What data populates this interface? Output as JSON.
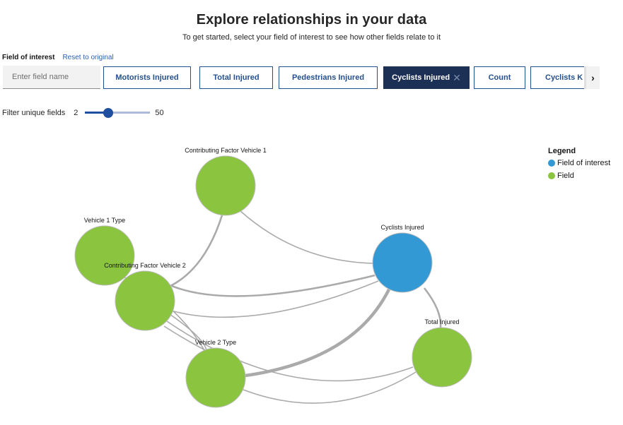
{
  "header": {
    "title": "Explore relationships in your data",
    "subtitle": "To get started, select your field of interest to see how other fields relate to it"
  },
  "field_of_interest": {
    "label": "Field of interest",
    "reset_label": "Reset to original",
    "input_placeholder": "Enter field name",
    "input_value": "",
    "chips": [
      {
        "label": "Motorists Injured",
        "selected": false
      },
      {
        "label": "Total Injured",
        "selected": false
      },
      {
        "label": "Pedestrians Injured",
        "selected": false
      },
      {
        "label": "Cyclists Injured",
        "selected": true,
        "close_icon": "close-icon"
      },
      {
        "label": "Count",
        "selected": false
      },
      {
        "label": "Cyclists K",
        "selected": false
      }
    ],
    "scroll_icon": "chevron-right-icon"
  },
  "filter": {
    "label": "Filter unique fields",
    "min": "2",
    "max": "50",
    "value_fraction": 0.35
  },
  "legend": {
    "title": "Legend",
    "items": [
      {
        "label": "Field of interest",
        "color": "#3399d4"
      },
      {
        "label": "Field",
        "color": "#8bc43f"
      }
    ]
  },
  "colors": {
    "field_of_interest": "#3399d4",
    "field": "#8bc43f",
    "edge": "#aaaaaa",
    "accent": "#24508f",
    "selected_chip": "#1c2f55"
  },
  "graph": {
    "nodes": [
      {
        "id": "cfv1",
        "label": "Contributing Factor Vehicle 1",
        "type": "field"
      },
      {
        "id": "v1t",
        "label": "Vehicle 1 Type",
        "type": "field"
      },
      {
        "id": "cfv2",
        "label": "Contributing Factor Vehicle 2",
        "type": "field"
      },
      {
        "id": "ci",
        "label": "Cyclists Injured",
        "type": "interest"
      },
      {
        "id": "ti",
        "label": "Total Injured",
        "type": "field"
      },
      {
        "id": "v2t",
        "label": "Vehicle 2 Type",
        "type": "field"
      }
    ],
    "edges": [
      {
        "source": "cfv1",
        "target": "ci",
        "weight": "light"
      },
      {
        "source": "cfv1",
        "target": "cfv2",
        "weight": "medium"
      },
      {
        "source": "cfv2",
        "target": "ci",
        "weight": "medium"
      },
      {
        "source": "cfv2",
        "target": "ci",
        "weight": "light"
      },
      {
        "source": "cfv2",
        "target": "v2t",
        "weight": "light"
      },
      {
        "source": "cfv2",
        "target": "ti",
        "weight": "light"
      },
      {
        "source": "v1t",
        "target": "v2t",
        "weight": "light"
      },
      {
        "source": "v2t",
        "target": "ci",
        "weight": "heavy"
      },
      {
        "source": "v2t",
        "target": "ti",
        "weight": "light"
      },
      {
        "source": "ci",
        "target": "ti",
        "weight": "medium"
      }
    ]
  }
}
